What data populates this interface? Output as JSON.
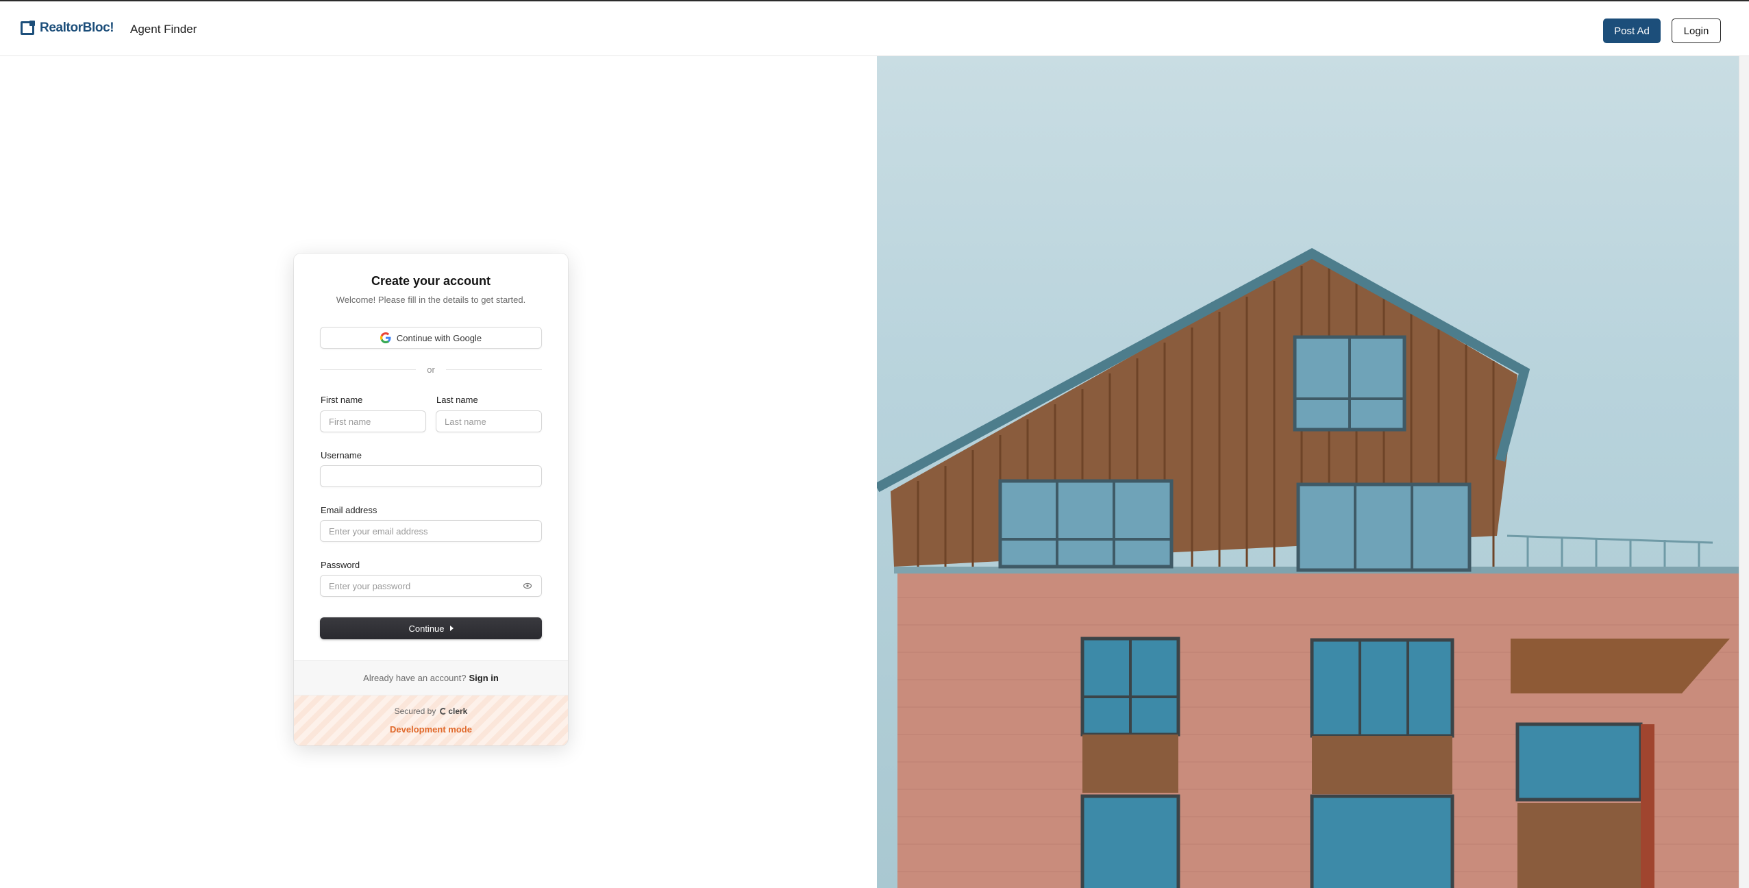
{
  "header": {
    "brand": "RealtorBloc!",
    "nav_link": "Agent Finder",
    "post_ad": "Post Ad",
    "login": "Login"
  },
  "form": {
    "title": "Create your account",
    "subtitle": "Welcome! Please fill in the details to get started.",
    "google": "Continue with Google",
    "or": "or",
    "first_name_label": "First name",
    "first_name_placeholder": "First name",
    "last_name_label": "Last name",
    "last_name_placeholder": "Last name",
    "username_label": "Username",
    "username_value": "",
    "email_label": "Email address",
    "email_placeholder": "Enter your email address",
    "password_label": "Password",
    "password_placeholder": "Enter your password",
    "continue": "Continue"
  },
  "footer": {
    "have_account": "Already have an account?",
    "sign_in": "Sign in",
    "secured_by": "Secured by",
    "clerk": "clerk",
    "dev_mode": "Development mode"
  },
  "colors": {
    "brand": "#1c4e7a",
    "dev_mode": "#e0692b",
    "primary_button": "#2f2f34"
  }
}
